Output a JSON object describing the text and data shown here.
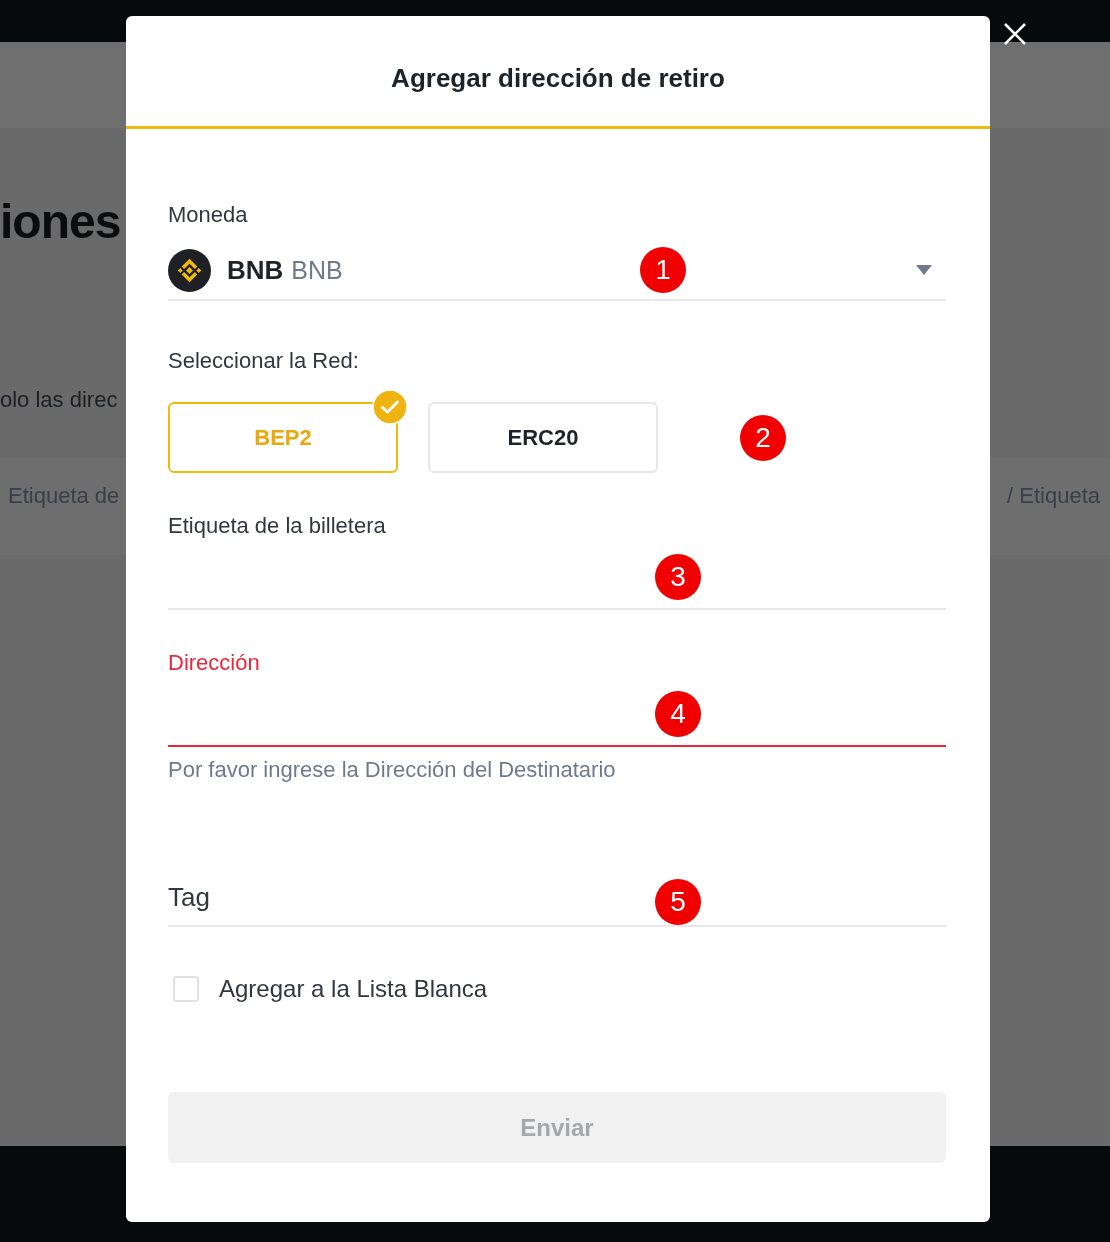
{
  "background_page": {
    "heading": "iones",
    "note": "olo las direc",
    "column_1": "Etiqueta de",
    "column_2": "/ Etiqueta"
  },
  "dialog": {
    "title": "Agregar dirección de retiro",
    "fields": [
      {
        "kind": "select",
        "label": "Moneda",
        "ticker": "BNB",
        "name": "BNB",
        "marker": "1"
      },
      {
        "kind": "choice",
        "label": "Seleccionar la Red:",
        "options": [
          {
            "label": "BEP2",
            "selected": true
          },
          {
            "label": "ERC20",
            "selected": false
          }
        ],
        "marker": "2"
      },
      {
        "kind": "labeled-input",
        "label": "Etiqueta de la billetera",
        "error": false,
        "marker": "3"
      },
      {
        "kind": "labeled-input",
        "label": "Dirección",
        "error": true,
        "message": "Por favor ingrese la Dirección del Destinatario",
        "marker": "4"
      },
      {
        "kind": "plain-input",
        "placeholder": "Tag",
        "marker": "5"
      },
      {
        "kind": "checkbox",
        "label": "Agregar a la Lista Blanca",
        "checked": false
      }
    ],
    "submit": {
      "label": "Enviar",
      "disabled": true
    }
  }
}
